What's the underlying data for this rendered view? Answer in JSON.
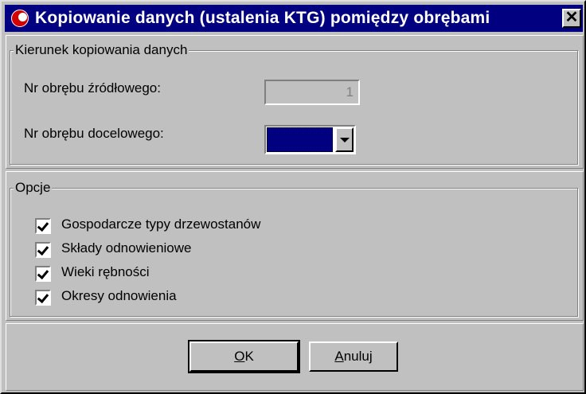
{
  "window": {
    "title": "Kopiowanie danych (ustalenia KTG) pomiędzy obrębami",
    "close_glyph": "✕"
  },
  "direction_group": {
    "legend": "Kierunek kopiowania danych",
    "source_label": "Nr obrębu źródłowego:",
    "source_value": "1",
    "target_label": "Nr obrębu docelowego:",
    "target_value": ""
  },
  "options_group": {
    "legend": "Opcje",
    "items": [
      {
        "label": "Gospodarcze typy drzewostanów",
        "checked": true
      },
      {
        "label": "Składy odnowieniowe",
        "checked": true
      },
      {
        "label": "Wieki rębności",
        "checked": true
      },
      {
        "label": "Okresy odnowienia",
        "checked": true
      }
    ]
  },
  "buttons": {
    "ok_hotkey": "O",
    "ok_rest": "K",
    "cancel_hotkey": "A",
    "cancel_rest": "nuluj"
  },
  "colors": {
    "titlebar": "#000080",
    "face": "#c0c0c0",
    "selection": "#000080",
    "app_icon": "#d40000"
  },
  "icons": {
    "app": "red-circle-app-icon",
    "close": "close-icon",
    "dropdown": "chevron-down-icon",
    "checkbox": "check-icon"
  }
}
